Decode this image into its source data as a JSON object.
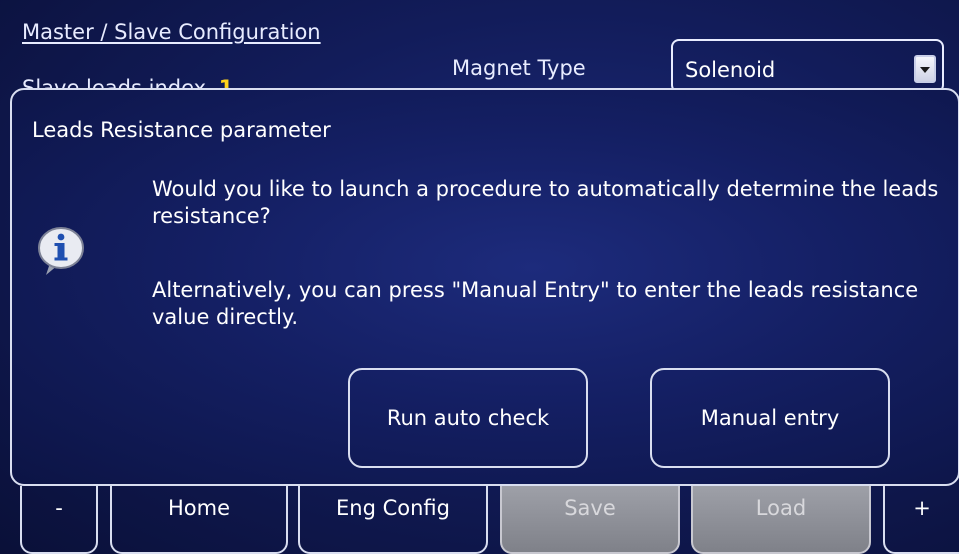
{
  "background": {
    "section_title": "Master / Slave Configuration",
    "slave_label": "Slave leads index",
    "slave_value": "1",
    "magnet_type_label": "Magnet Type",
    "magnet_type_value": "Solenoid"
  },
  "dialog": {
    "title": "Leads Resistance parameter",
    "message_line1": "Would you like to launch a procedure to automatically determine the leads resistance?",
    "message_line2": "Alternatively, you can press \"Manual Entry\" to enter the leads resistance value directly.",
    "run_button": "Run auto check",
    "manual_button": "Manual entry",
    "icon": "info-icon"
  },
  "bottom_bar": {
    "items": [
      {
        "label": "-",
        "enabled": true
      },
      {
        "label": "Home",
        "enabled": true
      },
      {
        "label": "Eng Config",
        "enabled": true
      },
      {
        "label": "Save",
        "enabled": false
      },
      {
        "label": "Load",
        "enabled": false
      },
      {
        "label": "+",
        "enabled": true
      }
    ]
  },
  "colors": {
    "background": "#121c5a",
    "accent_yellow": "#ffd21a",
    "disabled_button": "#8f9199"
  }
}
